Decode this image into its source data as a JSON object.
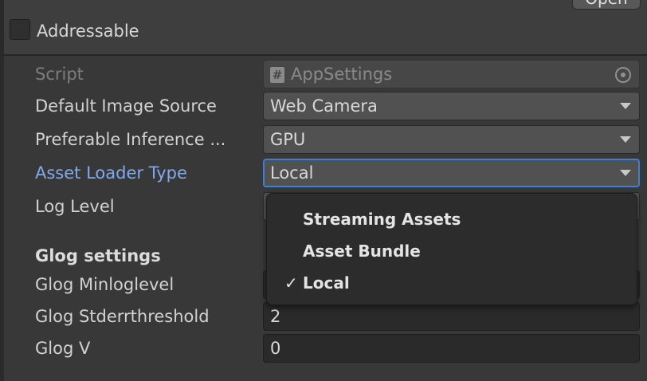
{
  "header": {
    "open_button": "Open",
    "addressable_label": "Addressable",
    "addressable_checked": false
  },
  "fields": {
    "script": {
      "label": "Script",
      "value": "AppSettings",
      "icon": "csharp-script-icon"
    },
    "default_image_source": {
      "label": "Default Image Source",
      "value": "Web Camera"
    },
    "preferable_inference": {
      "label": "Preferable Inference ...",
      "value": "GPU"
    },
    "asset_loader_type": {
      "label": "Asset Loader Type",
      "value": "Local"
    },
    "log_level": {
      "label": "Log Level",
      "value": ""
    }
  },
  "glog": {
    "heading": "Glog settings",
    "minloglevel": {
      "label": "Glog Minloglevel",
      "value": ""
    },
    "stderrthreshold": {
      "label": "Glog Stderrthreshold",
      "value": "2"
    },
    "v": {
      "label": "Glog V",
      "value": "0"
    }
  },
  "dropdown": {
    "options": [
      "Streaming Assets",
      "Asset Bundle",
      "Local"
    ],
    "selected": "Local",
    "check_glyph": "✓"
  },
  "colors": {
    "background": "#383838",
    "focus_border": "#3f7fd1",
    "active_label": "#7eaaf2"
  }
}
